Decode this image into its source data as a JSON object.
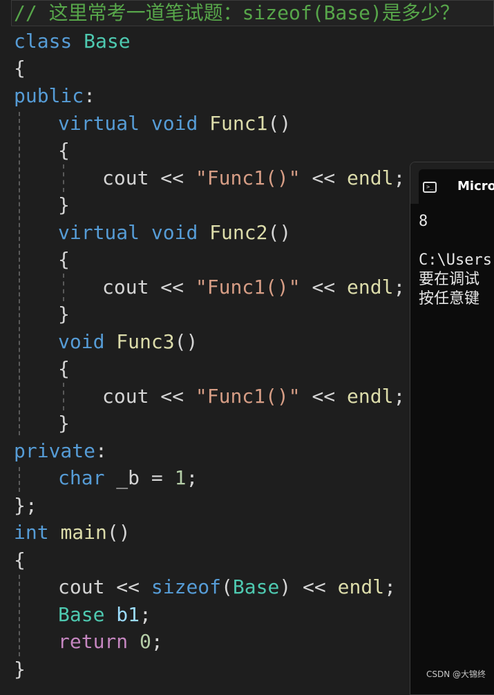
{
  "editor": {
    "comment": "// 这里常考一道笔试题：sizeof(Base)是多少？",
    "code": {
      "l1_kw": "class",
      "l1_type": "Base",
      "open_brace": "{",
      "l3_kw": "public",
      "colon": ":",
      "virtual": "virtual",
      "void": "void",
      "func1": "Func1",
      "func2": "Func2",
      "func3": "Func3",
      "parens": "()",
      "cout": "cout",
      "shl": "<<",
      "str_func1": "\"Func1()\"",
      "endl": "endl",
      "semi": ";",
      "close_brace": "}",
      "private_kw": "private",
      "char_kw": "char",
      "member": "_b = ",
      "one": "1",
      "class_end": "};",
      "int_kw": "int",
      "main": "main",
      "sizeof": "sizeof",
      "open_paren": "(",
      "close_paren": ")",
      "base_type": "Base",
      "b1": "b1",
      "return_kw": "return",
      "zero": "0"
    }
  },
  "console": {
    "title": "Micros",
    "icon": "console-window-icon",
    "output": "8",
    "path": "C:\\Users",
    "msg1": "要在调试",
    "msg2": "按任意键"
  },
  "watermark": "CSDN @大锦终",
  "colors": {
    "background": "#1e1e1e",
    "keyword": "#569cd6",
    "type": "#4ec9b0",
    "function": "#dcdcaa",
    "string": "#d69d85",
    "comment": "#57a64a"
  }
}
